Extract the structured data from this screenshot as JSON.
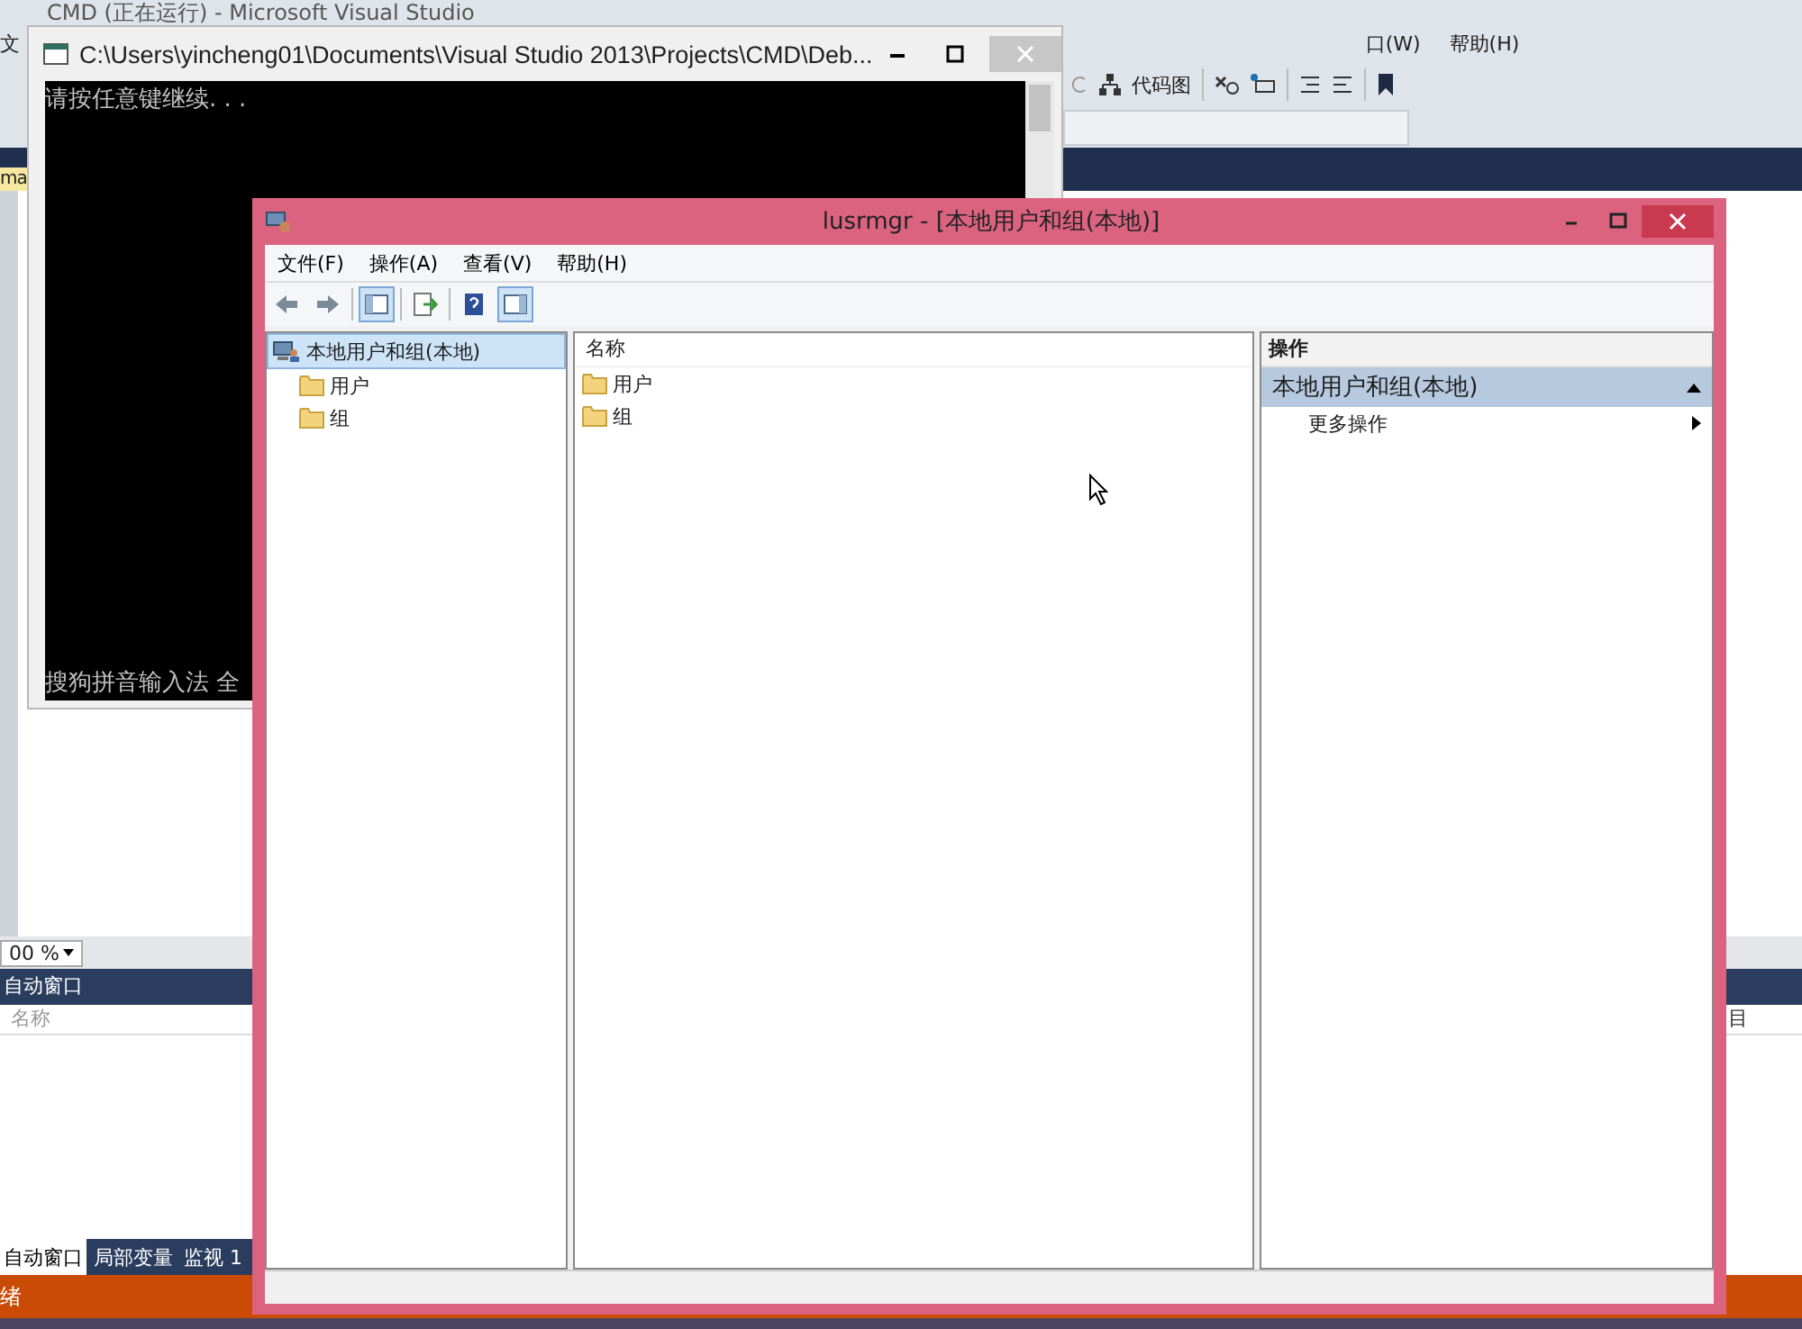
{
  "background_window": {
    "title": "CMD (正在运行) - Microsoft Visual Studio",
    "menu_fragments": [
      "文",
      "口(W)",
      "帮助(H)"
    ],
    "toolbar_button": "代码图",
    "side_tab": "ma",
    "zoom_combo": "00 %",
    "panel_title": "自动窗口",
    "panel_column": "名称",
    "panel_tabs": [
      {
        "label": "自动窗口",
        "selected": true
      },
      {
        "label": "局部变量",
        "selected": false
      },
      {
        "label": "监视 1",
        "selected": false
      }
    ],
    "side_column": "目",
    "status": "绪"
  },
  "console_window": {
    "title": "C:\\Users\\yincheng01\\Documents\\Visual Studio 2013\\Projects\\CMD\\Deb...",
    "lines": [
      "请按任意键继续. . ."
    ],
    "ime_status": "搜狗拼音输入法 全"
  },
  "mmc_window": {
    "title": "lusrmgr - [本地用户和组(本地)]",
    "menu": [
      "文件(F)",
      "操作(A)",
      "查看(V)",
      "帮助(H)"
    ],
    "toolbar": [
      {
        "kind": "back",
        "pressed": false
      },
      {
        "kind": "forward",
        "pressed": false
      },
      {
        "kind": "tree",
        "pressed": true
      },
      {
        "kind": "export",
        "pressed": false
      },
      {
        "kind": "help",
        "pressed": false
      },
      {
        "kind": "actions",
        "pressed": true
      }
    ],
    "tree": [
      {
        "label": "本地用户和组(本地)",
        "selected": true,
        "children": [
          {
            "label": "用户",
            "selected": false
          },
          {
            "label": "组",
            "selected": false
          }
        ]
      }
    ],
    "list": {
      "columns": [
        "名称"
      ],
      "rows": [
        "用户",
        "组"
      ]
    },
    "actions": {
      "header": "操作",
      "sections": [
        {
          "title": "本地用户和组(本地)",
          "expanded": true,
          "items": [
            "更多操作"
          ]
        }
      ]
    }
  }
}
